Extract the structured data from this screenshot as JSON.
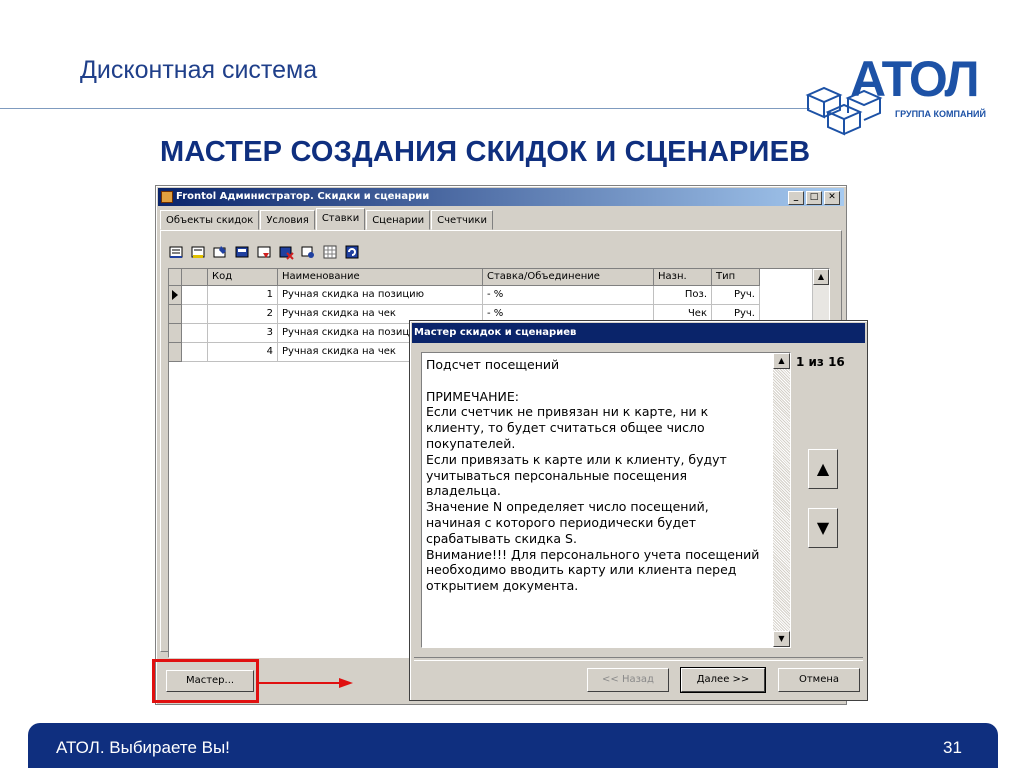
{
  "slide": {
    "title": "Дисконтная система",
    "headline": "МАСТЕР СОЗДАНИЯ СКИДОК И СЦЕНАРИЕВ",
    "logo_text": "АТОЛ",
    "logo_sub": "ГРУППА КОМПАНИЙ",
    "footer_left": "АТОЛ. Выбираете Вы!",
    "footer_page": "31",
    "colors": {
      "brand_blue": "#1d52a6",
      "footer_blue": "#0f2f7f",
      "highlight_red": "#e01010"
    }
  },
  "window": {
    "title": "Frontol Администратор.  Скидки и сценарии",
    "buttons": {
      "minimize": "_",
      "maximize": "□",
      "close": "✕"
    },
    "tabs": [
      {
        "label": "Объекты скидок"
      },
      {
        "label": "Условия"
      },
      {
        "label": "Ставки",
        "active": true
      },
      {
        "label": "Сценарии"
      },
      {
        "label": "Счетчики"
      }
    ],
    "toolbar_icons": [
      "add-icon",
      "edit-icon",
      "edit-alt-icon",
      "copy-icon",
      "move-icon",
      "delete-icon",
      "properties-icon",
      "grid-icon",
      "refresh-icon"
    ],
    "table": {
      "headers": [
        "Код",
        "Наименование",
        "Ставка/Объединение",
        "Назн.",
        "Тип"
      ],
      "rows": [
        {
          "code": "1",
          "name": "Ручная скидка на позицию",
          "rate": "- %",
          "dest": "Поз.",
          "type": "Руч."
        },
        {
          "code": "2",
          "name": "Ручная скидка на чек",
          "rate": "- %",
          "dest": "Чек",
          "type": "Руч."
        },
        {
          "code": "3",
          "name": "Ручная скидка на позиц",
          "rate": "",
          "dest": "",
          "type": ""
        },
        {
          "code": "4",
          "name": "Ручная скидка на чек",
          "rate": "",
          "dest": "",
          "type": ""
        }
      ]
    },
    "master_button": "Мастер..."
  },
  "wizard": {
    "title": "Мастер скидок и сценариев",
    "text": "Подсчет посещений\n\nПРИМЕЧАНИЕ:\nЕсли счетчик не привязан ни к карте, ни к\nклиенту, то будет считаться общее число\nпокупателей.\nЕсли привязать к карте или к клиенту, будут\nучитываться персональные посещения\nвладельца.\nЗначение N определяет число посещений,\nначиная с которого периодически будет\nсрабатывать скидка S.\nВнимание!!! Для персонального учета посещений\nнеобходимо вводить карту или клиента перед\nоткрытием документа.",
    "counter": "1 из 16",
    "up_arrow": "▲",
    "down_arrow": "▼",
    "back_button": "<< Назад",
    "next_button": "Далее >>",
    "cancel_button": "Отмена"
  }
}
